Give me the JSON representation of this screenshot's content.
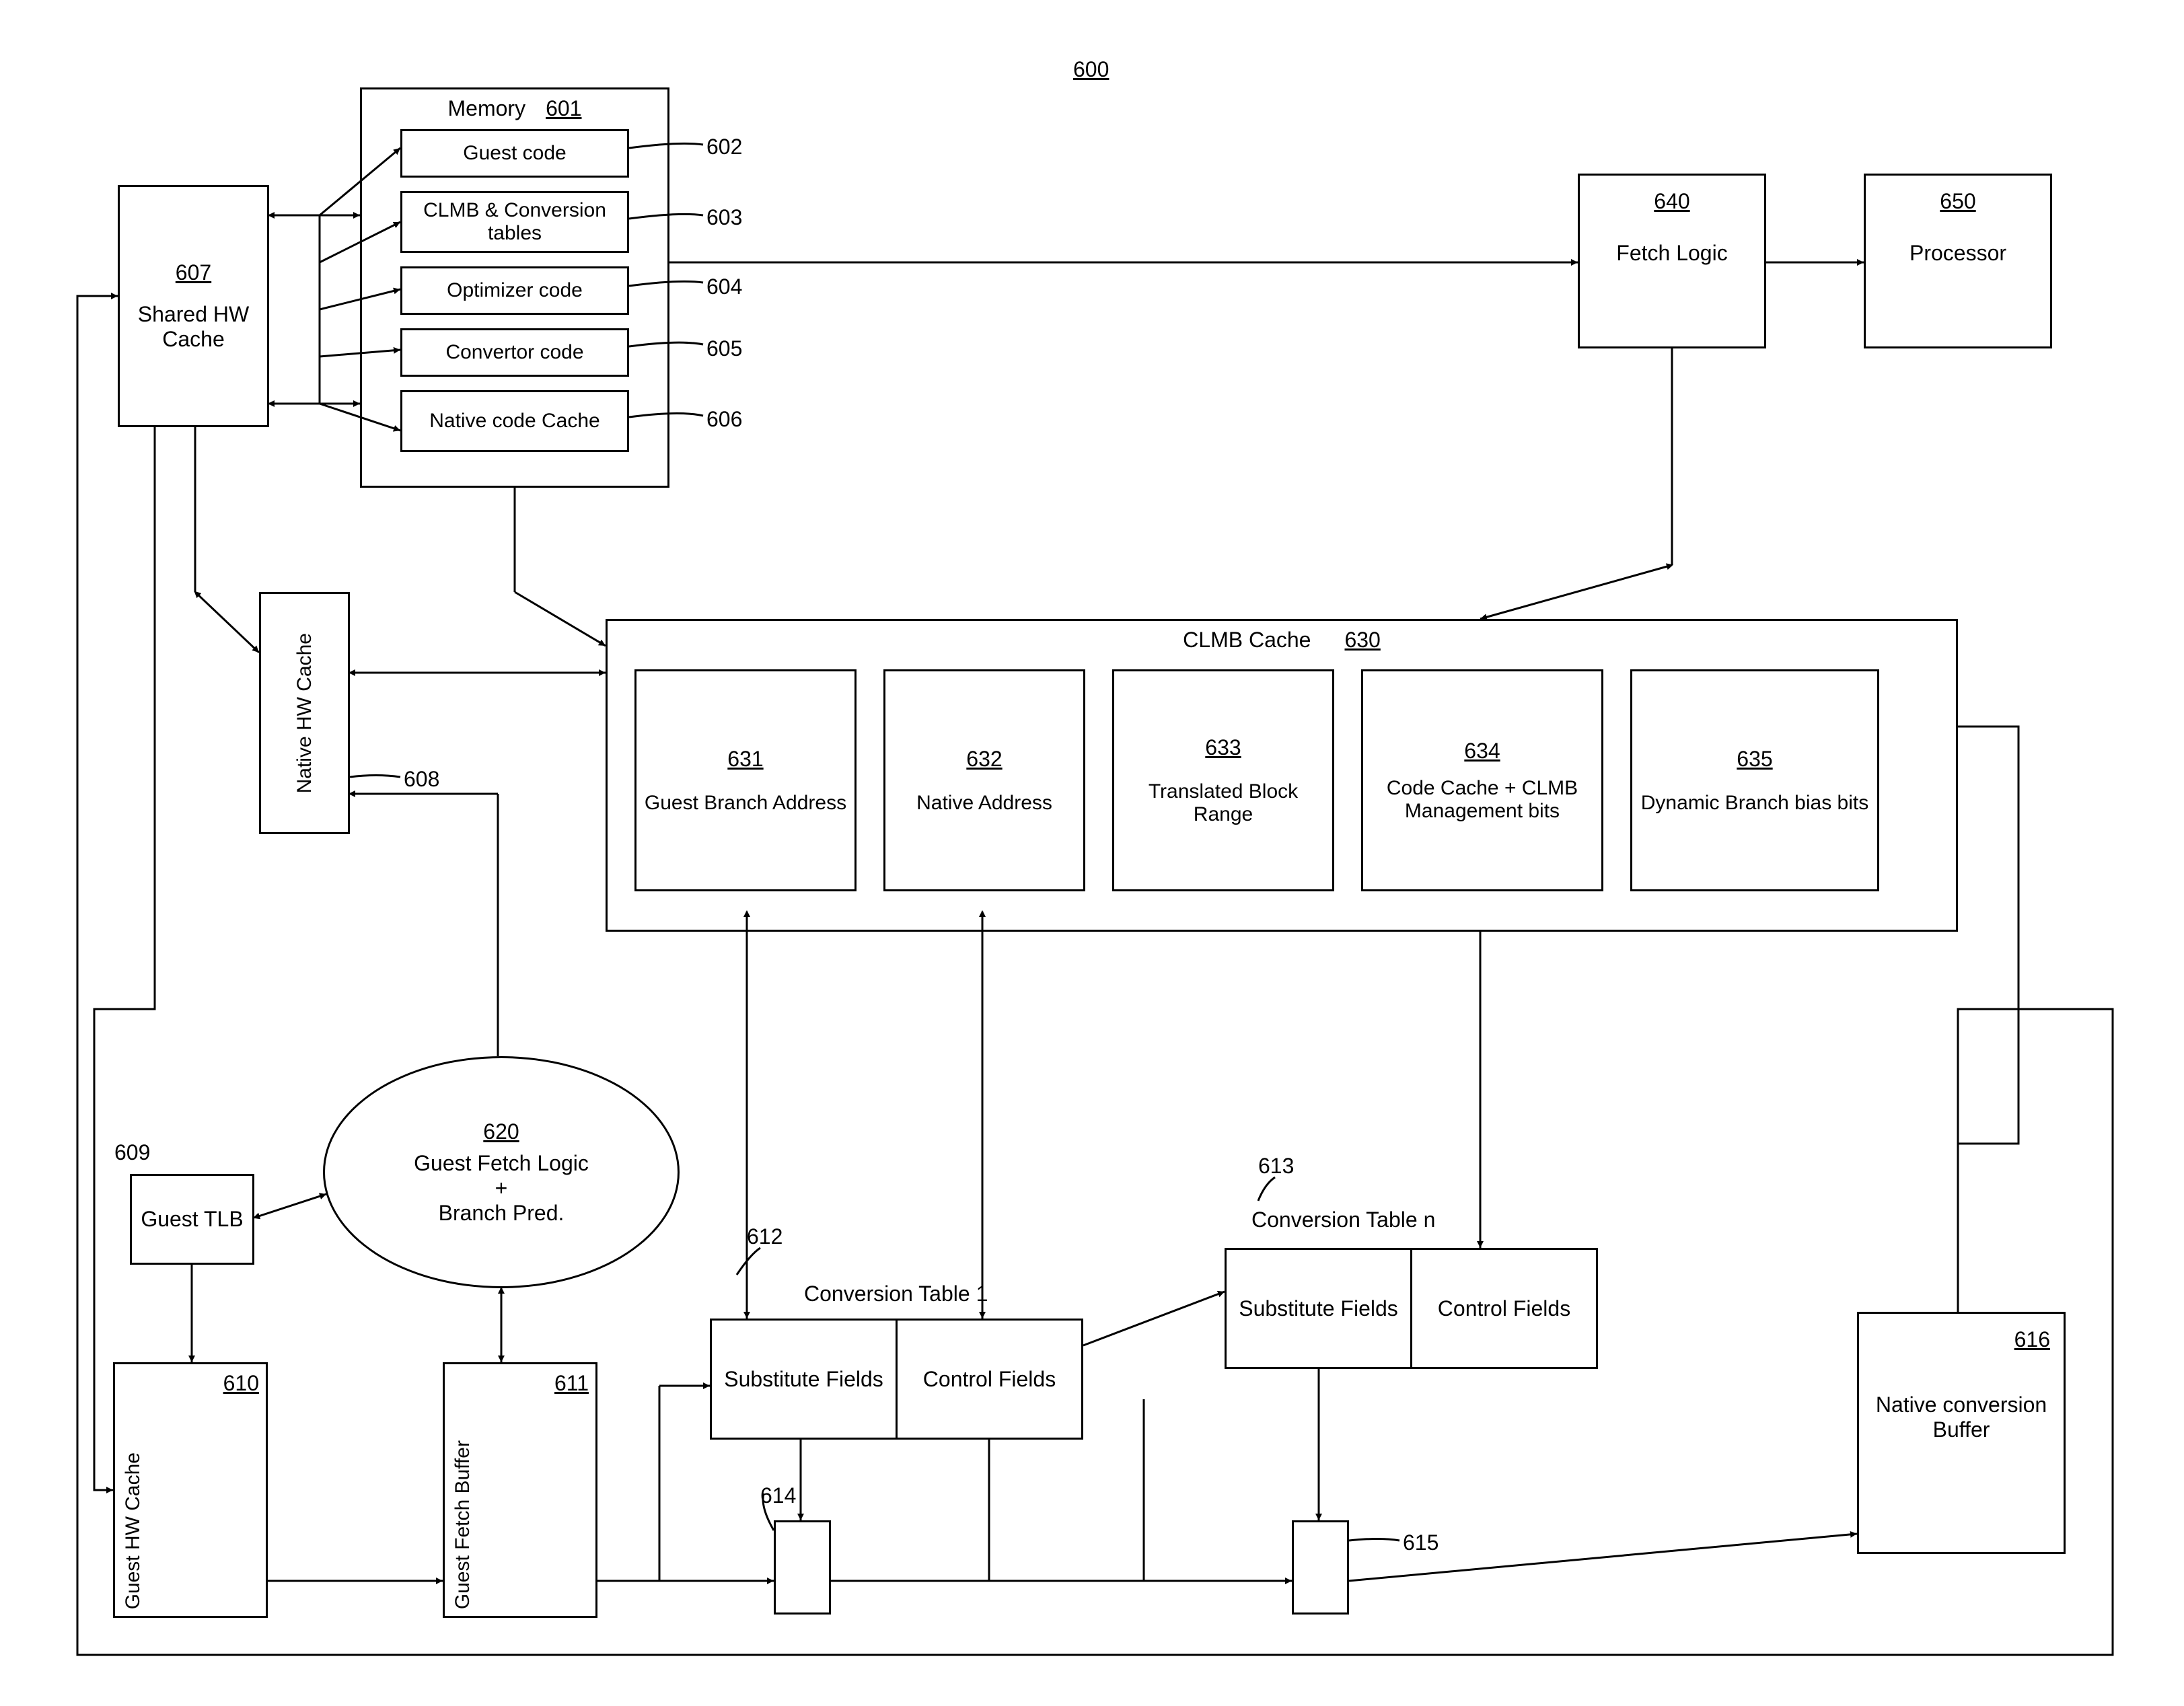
{
  "diagram_ref": "600",
  "shared_hw_cache": {
    "ref": "607",
    "label": "Shared HW Cache"
  },
  "memory": {
    "ref": "601",
    "label": "Memory",
    "items": [
      {
        "ref": "602",
        "label": "Guest code"
      },
      {
        "ref": "603",
        "label": "CLMB & Conversion tables"
      },
      {
        "ref": "604",
        "label": "Optimizer code"
      },
      {
        "ref": "605",
        "label": "Convertor code"
      },
      {
        "ref": "606",
        "label": "Native code Cache"
      }
    ]
  },
  "fetch_logic": {
    "ref": "640",
    "label": "Fetch Logic"
  },
  "processor": {
    "ref": "650",
    "label": "Processor"
  },
  "native_hw_cache": {
    "ref": "608",
    "label": "Native HW Cache"
  },
  "clmb_cache": {
    "ref": "630",
    "label": "CLMB Cache",
    "items": [
      {
        "ref": "631",
        "label": "Guest Branch Address"
      },
      {
        "ref": "632",
        "label": "Native Address"
      },
      {
        "ref": "633",
        "label": "Translated Block Range"
      },
      {
        "ref": "634",
        "label": "Code Cache + CLMB Management bits"
      },
      {
        "ref": "635",
        "label": "Dynamic Branch bias bits"
      }
    ]
  },
  "guest_tlb": {
    "ref": "609",
    "label": "Guest TLB"
  },
  "guest_hw_cache": {
    "ref": "610",
    "label": "Guest HW Cache"
  },
  "guest_fetch_buffer": {
    "ref": "611",
    "label": "Guest Fetch Buffer"
  },
  "guest_fetch_ellipse": {
    "ref": "620",
    "label_line1": "Guest Fetch Logic",
    "label_line2": "+",
    "label_line3": "Branch Pred."
  },
  "conv_table_1": {
    "ref": "612",
    "label": "Conversion Table 1",
    "sub_fields": "Substitute Fields",
    "ctrl_fields": "Control Fields"
  },
  "conv_table_n": {
    "ref": "613",
    "label": "Conversion Table n",
    "sub_fields": "Substitute Fields",
    "ctrl_fields": "Control Fields"
  },
  "mux_614": {
    "ref": "614"
  },
  "mux_615": {
    "ref": "615"
  },
  "native_conv_buffer": {
    "ref": "616",
    "label": "Native conversion Buffer"
  }
}
